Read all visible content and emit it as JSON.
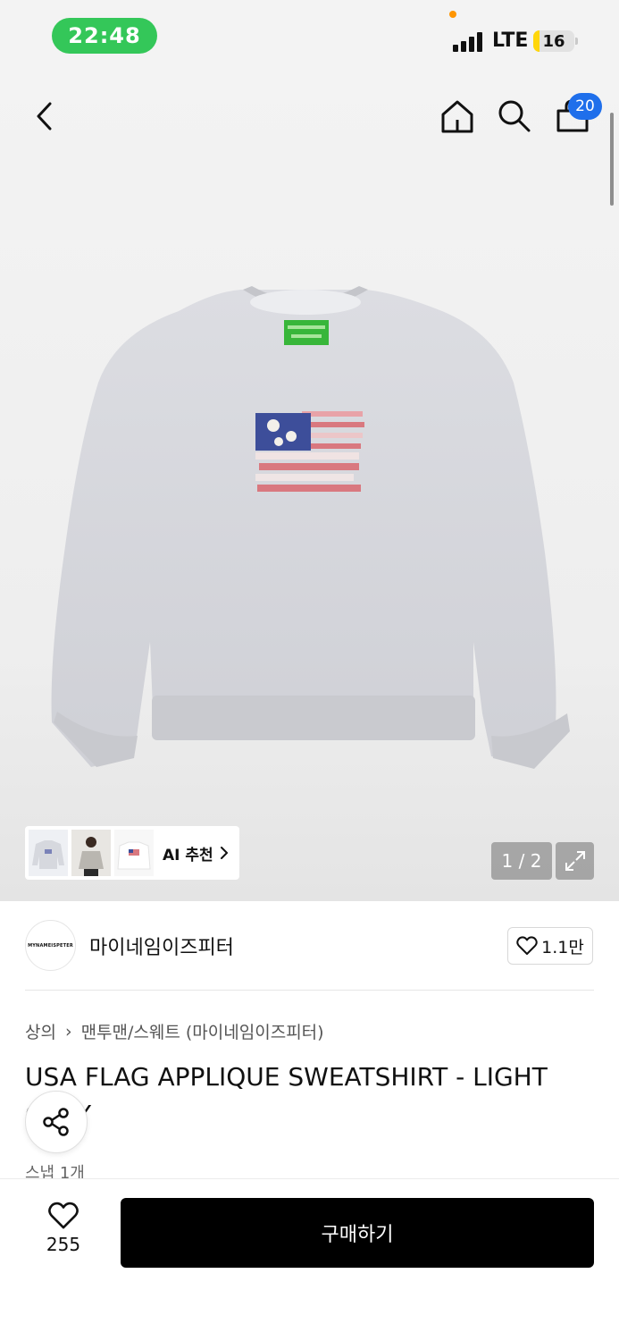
{
  "status_bar": {
    "time": "22:48",
    "network": "LTE",
    "battery": "16",
    "battery_level": 0.16
  },
  "header": {
    "back_icon": "chevron-left-icon",
    "home_icon": "home-icon",
    "search_icon": "search-icon",
    "cart_icon": "shopping-bag-icon",
    "cart_count": "20"
  },
  "gallery": {
    "ai_recommend_label": "AI 추천",
    "page_indicator": "1 / 2",
    "expand_icon": "expand-icon"
  },
  "brand": {
    "logo_text": "MYNAMEISPETER",
    "name": "마이네임이즈피터",
    "like_count": "1.1만"
  },
  "product": {
    "breadcrumb": [
      "상의",
      "맨투맨/스웨트 (마이네임이즈피터)"
    ],
    "title": "USA FLAG APPLIQUE SWEATSHIRT - LIGHT GRAY",
    "snap": "스냅 1개"
  },
  "bottom": {
    "wish_count": "255",
    "buy_label": "구매하기"
  },
  "colors": {
    "accent_blue": "#1f6feb",
    "status_green": "#34c759",
    "buy_button": "#000000"
  }
}
